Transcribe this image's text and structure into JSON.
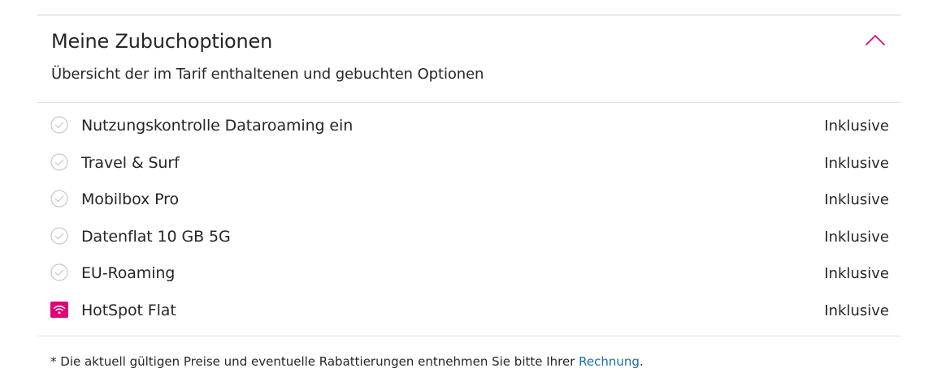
{
  "section": {
    "title": "Meine Zubuchoptionen",
    "subtitle": "Übersicht der im Tarif enthaltenen und gebuchten Optionen",
    "toggle_icon": "chevron-up-icon",
    "accent_color": "#e20074"
  },
  "options": [
    {
      "label": "Nutzungskontrolle Dataroaming ein",
      "price": "Inklusive",
      "icon": "check-circle-icon"
    },
    {
      "label": "Travel & Surf",
      "price": "Inklusive",
      "icon": "check-circle-icon"
    },
    {
      "label": "Mobilbox Pro",
      "price": "Inklusive",
      "icon": "check-circle-icon"
    },
    {
      "label": "Datenflat 10 GB 5G",
      "price": "Inklusive",
      "icon": "check-circle-icon"
    },
    {
      "label": "EU-Roaming",
      "price": "Inklusive",
      "icon": "check-circle-icon"
    },
    {
      "label": "HotSpot Flat",
      "price": "Inklusive",
      "icon": "wifi-icon"
    }
  ],
  "footnote": {
    "text": "* Die aktuell gültigen Preise und eventuelle Rabattierungen entnehmen Sie bitte Ihrer ",
    "link_label": "Rechnung",
    "suffix": "."
  }
}
